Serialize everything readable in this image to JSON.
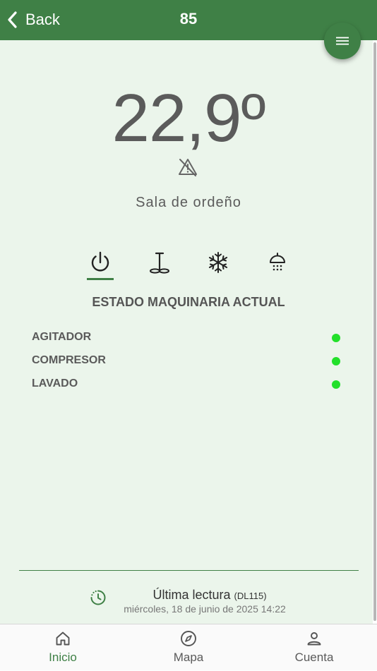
{
  "header": {
    "back_label": "Back",
    "title": "85",
    "menu_icon": "hamburger-menu-icon"
  },
  "reading": {
    "temperature": "22,9º",
    "alarm_icon": "alarm-off-icon",
    "location": "Sala de ordeño"
  },
  "tabs": [
    {
      "icon": "power-icon",
      "active": true
    },
    {
      "icon": "agitator-icon",
      "active": false
    },
    {
      "icon": "snowflake-icon",
      "active": false
    },
    {
      "icon": "shower-icon",
      "active": false
    }
  ],
  "machinery": {
    "title": "ESTADO MAQUINARIA ACTUAL",
    "items": [
      {
        "name": "AGITADOR",
        "status_color": "#22e02a"
      },
      {
        "name": "COMPRESOR",
        "status_color": "#22e02a"
      },
      {
        "name": "LAVADO",
        "status_color": "#22e02a"
      }
    ]
  },
  "last_reading": {
    "label": "Última lectura",
    "device": "(DL115)",
    "date": "miércoles, 18 de junio de 2025 14:22",
    "icon": "clock-history-icon"
  },
  "nav": [
    {
      "label": "Inicio",
      "icon": "home-icon",
      "active": true
    },
    {
      "label": "Mapa",
      "icon": "compass-icon",
      "active": false
    },
    {
      "label": "Cuenta",
      "icon": "account-icon",
      "active": false
    }
  ],
  "colors": {
    "primary": "#3f8046",
    "background": "#ebf5eb",
    "status_ok": "#22e02a"
  }
}
